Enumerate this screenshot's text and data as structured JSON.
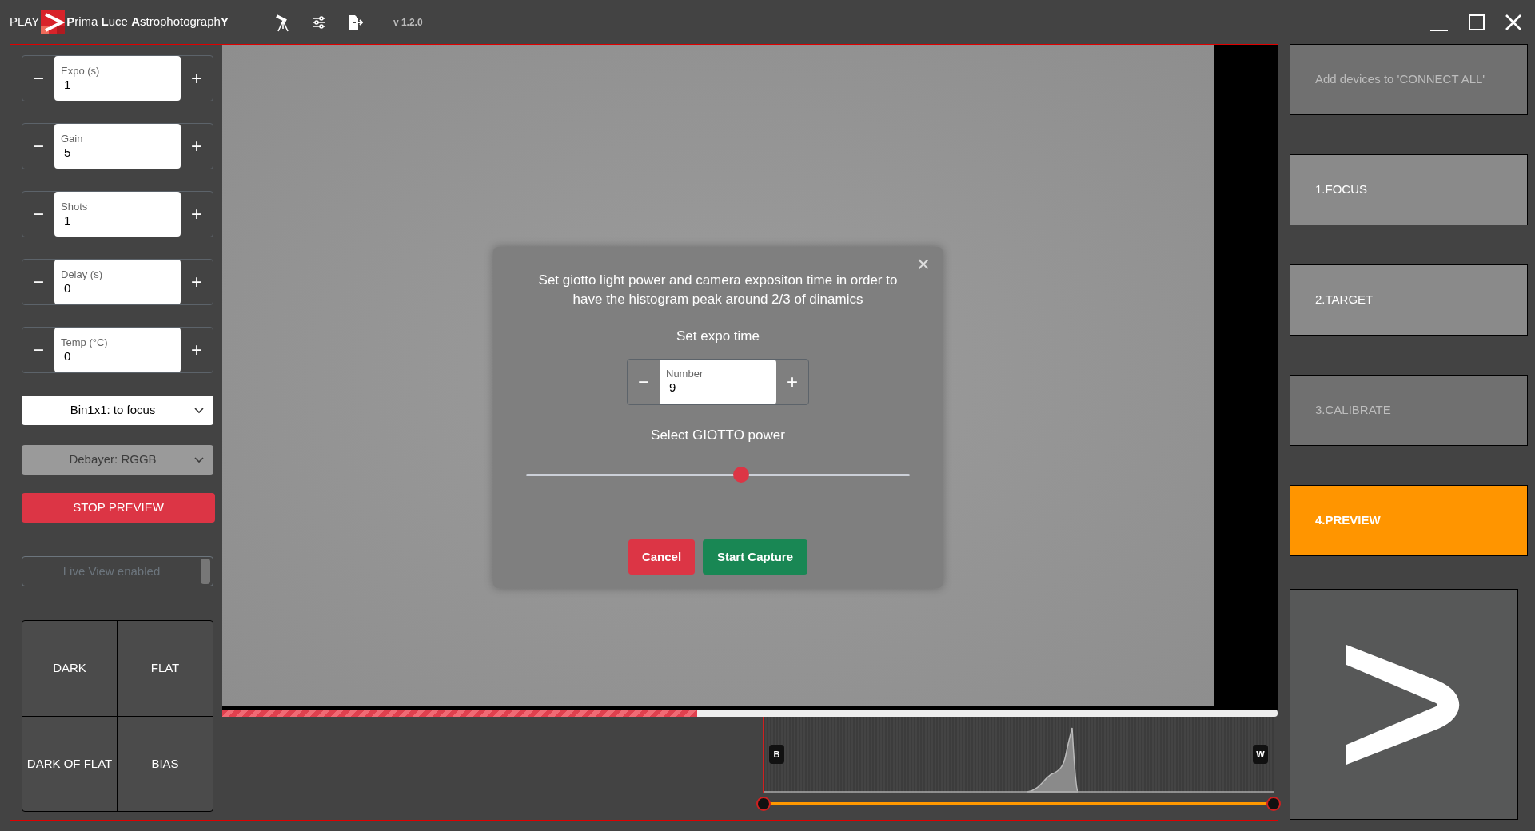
{
  "app": {
    "brand_prefix": "PLAY",
    "brand_name": "**P**rima **L**uce **A**strophotograph**Y**",
    "version": "v 1.2.0"
  },
  "steppers": [
    {
      "label": "Expo (s)",
      "value": "1",
      "minus": "−",
      "plus": "+"
    },
    {
      "label": "Gain",
      "value": "5",
      "minus": "−",
      "plus": "+"
    },
    {
      "label": "Shots",
      "value": "1",
      "minus": "−",
      "plus": "+"
    },
    {
      "label": "Delay (s)",
      "value": "0",
      "minus": "−",
      "plus": "+"
    },
    {
      "label": "Temp (°C)",
      "value": "0",
      "minus": "−",
      "plus": "+"
    }
  ],
  "selects": [
    {
      "value": "Bin1x1: to focus",
      "disabled": false
    },
    {
      "value": "Debayer: RGGB",
      "disabled": true
    }
  ],
  "stop_button": "STOP PREVIEW",
  "live_view": {
    "label": "Live View enabled",
    "disabled": true
  },
  "calibration_buttons": [
    "DARK",
    "FLAT",
    "DARK OF FLAT",
    "BIAS"
  ],
  "progress": {
    "level": 0.45
  },
  "histogram": {
    "black_label": "B",
    "white_label": "W",
    "range": [
      {
        "level": 0
      },
      {
        "level": 1
      }
    ]
  },
  "dialog": {
    "message": "Set giotto light power and camera expositon time in order to have the histogram peak around 2/3 of dinamics",
    "close": "×",
    "expo_title": "Set expo time",
    "expo": {
      "label": "Number",
      "value": "9",
      "minus": "−",
      "plus": "+"
    },
    "power_title": "Select GIOTTO power",
    "power": {
      "level": 0.56
    },
    "cancel": "Cancel",
    "start": "Start Capture"
  },
  "nav": [
    {
      "label": "Add devices to 'CONNECT ALL'",
      "disabled": true,
      "selected": false
    },
    {
      "label": "1.FOCUS",
      "disabled": false,
      "selected": false
    },
    {
      "label": "2.TARGET",
      "disabled": false,
      "selected": false
    },
    {
      "label": "3.CALIBRATE",
      "disabled": true,
      "selected": false
    },
    {
      "label": "4.PREVIEW",
      "disabled": false,
      "selected": true
    }
  ]
}
